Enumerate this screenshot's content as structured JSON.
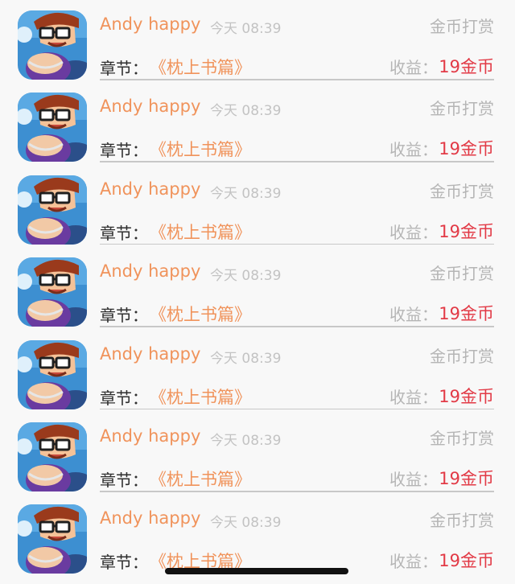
{
  "list": {
    "items": [
      {
        "username": "Andy happy",
        "time": "今天 08:39",
        "type_label": "金币打赏",
        "chapter_label": "章节：",
        "chapter_name": "《枕上书篇》",
        "earnings_label": "收益：",
        "earnings_value": "19金币"
      },
      {
        "username": "Andy happy",
        "time": "今天 08:39",
        "type_label": "金币打赏",
        "chapter_label": "章节：",
        "chapter_name": "《枕上书篇》",
        "earnings_label": "收益：",
        "earnings_value": "19金币"
      },
      {
        "username": "Andy happy",
        "time": "今天 08:39",
        "type_label": "金币打赏",
        "chapter_label": "章节：",
        "chapter_name": "《枕上书篇》",
        "earnings_label": "收益：",
        "earnings_value": "19金币"
      },
      {
        "username": "Andy happy",
        "time": "今天 08:39",
        "type_label": "金币打赏",
        "chapter_label": "章节：",
        "chapter_name": "《枕上书篇》",
        "earnings_label": "收益：",
        "earnings_value": "19金币"
      },
      {
        "username": "Andy happy",
        "time": "今天 08:39",
        "type_label": "金币打赏",
        "chapter_label": "章节：",
        "chapter_name": "《枕上书篇》",
        "earnings_label": "收益：",
        "earnings_value": "19金币"
      },
      {
        "username": "Andy happy",
        "time": "今天 08:39",
        "type_label": "金币打赏",
        "chapter_label": "章节：",
        "chapter_name": "《枕上书篇》",
        "earnings_label": "收益：",
        "earnings_value": "19金币"
      },
      {
        "username": "Andy happy",
        "time": "今天 08:39",
        "type_label": "金币打赏",
        "chapter_label": "章节：",
        "chapter_name": "《枕上书篇》",
        "earnings_label": "收益：",
        "earnings_value": "19金币"
      }
    ]
  },
  "colors": {
    "background": "#f8f8f8",
    "username": "#f0935b",
    "chapter_name": "#f0935b",
    "earnings_value": "#e23a46",
    "muted_text": "#b5b5b5",
    "time_text": "#c3c3c3",
    "label_text": "#2e2e2e",
    "divider": "#c8c8c8"
  },
  "icons": {
    "avatar": "cartoon-avatar-with-glasses"
  }
}
